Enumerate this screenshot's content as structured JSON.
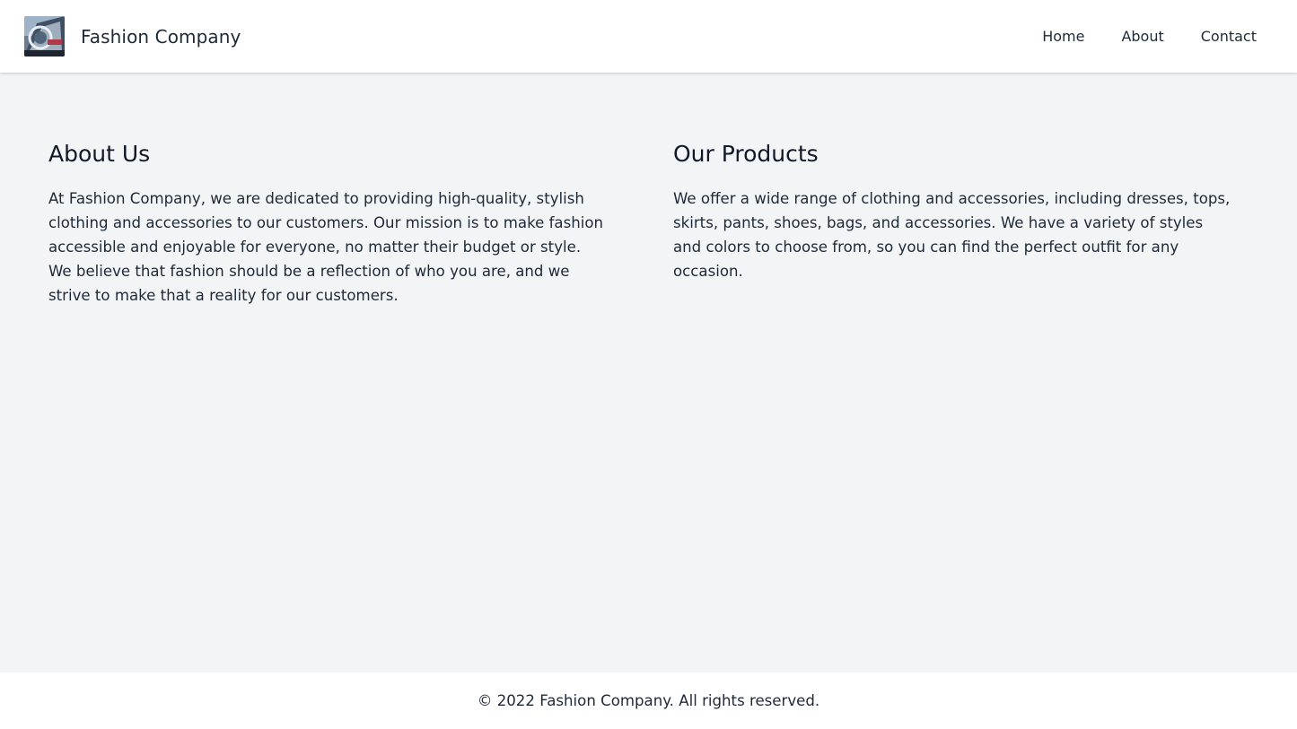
{
  "header": {
    "brand_name": "Fashion Company",
    "logo_icon": "fashion-logo-image",
    "nav": [
      {
        "label": "Home"
      },
      {
        "label": "About"
      },
      {
        "label": "Contact"
      }
    ]
  },
  "sections": [
    {
      "title": "About Us",
      "body": "At Fashion Company, we are dedicated to providing high-quality, stylish clothing and accessories to our customers. Our mission is to make fashion accessible and enjoyable for everyone, no matter their budget or style. We believe that fashion should be a reflection of who you are, and we strive to make that a reality for our customers."
    },
    {
      "title": "Our Products",
      "body": "We offer a wide range of clothing and accessories, including dresses, tops, skirts, pants, shoes, bags, and accessories. We have a variety of styles and colors to choose from, so you can find the perfect outfit for any occasion."
    }
  ],
  "footer": {
    "text": "© 2022 Fashion Company. All rights reserved."
  },
  "colors": {
    "page_bg": "#f3f4f6",
    "header_bg": "#ffffff",
    "text": "#1f2937"
  }
}
